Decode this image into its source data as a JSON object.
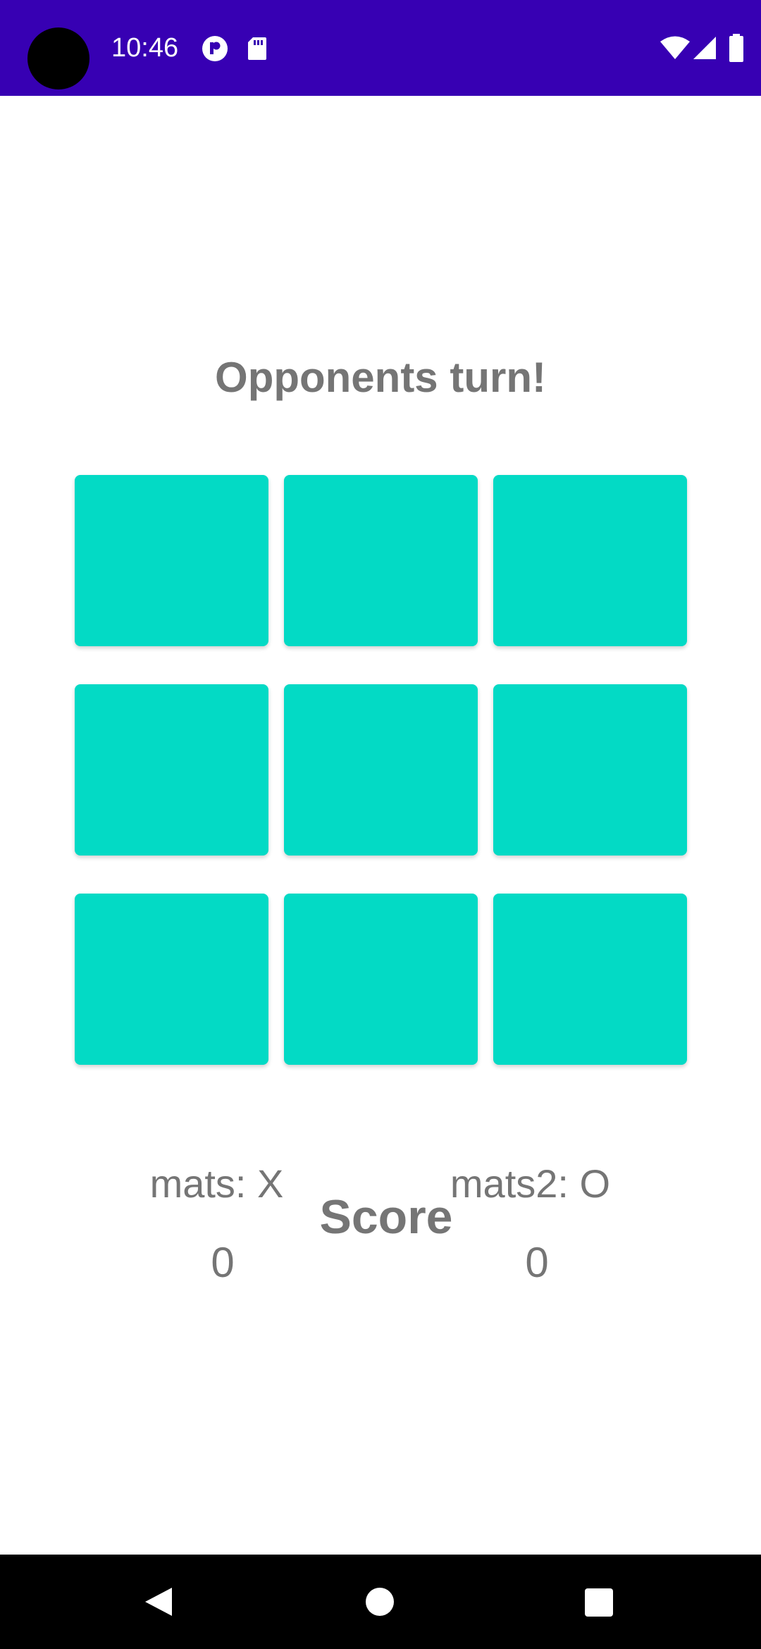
{
  "status_bar": {
    "time": "10:46",
    "background_color": "#3700b3",
    "icons": [
      "circle-p-icon",
      "sd-card-icon",
      "wifi-icon",
      "signal-icon",
      "battery-icon"
    ]
  },
  "game": {
    "turn_message": "Opponents turn!",
    "board": {
      "cell_color": "#03dac5",
      "cells": [
        "",
        "",
        "",
        "",
        "",
        "",
        "",
        "",
        ""
      ]
    }
  },
  "score": {
    "title": "Score",
    "player1": {
      "label": "mats: X",
      "score": "0"
    },
    "player2": {
      "label": "mats2: O",
      "score": "0"
    }
  },
  "nav_bar": {
    "buttons": [
      "back-icon",
      "home-icon",
      "recents-icon"
    ]
  }
}
